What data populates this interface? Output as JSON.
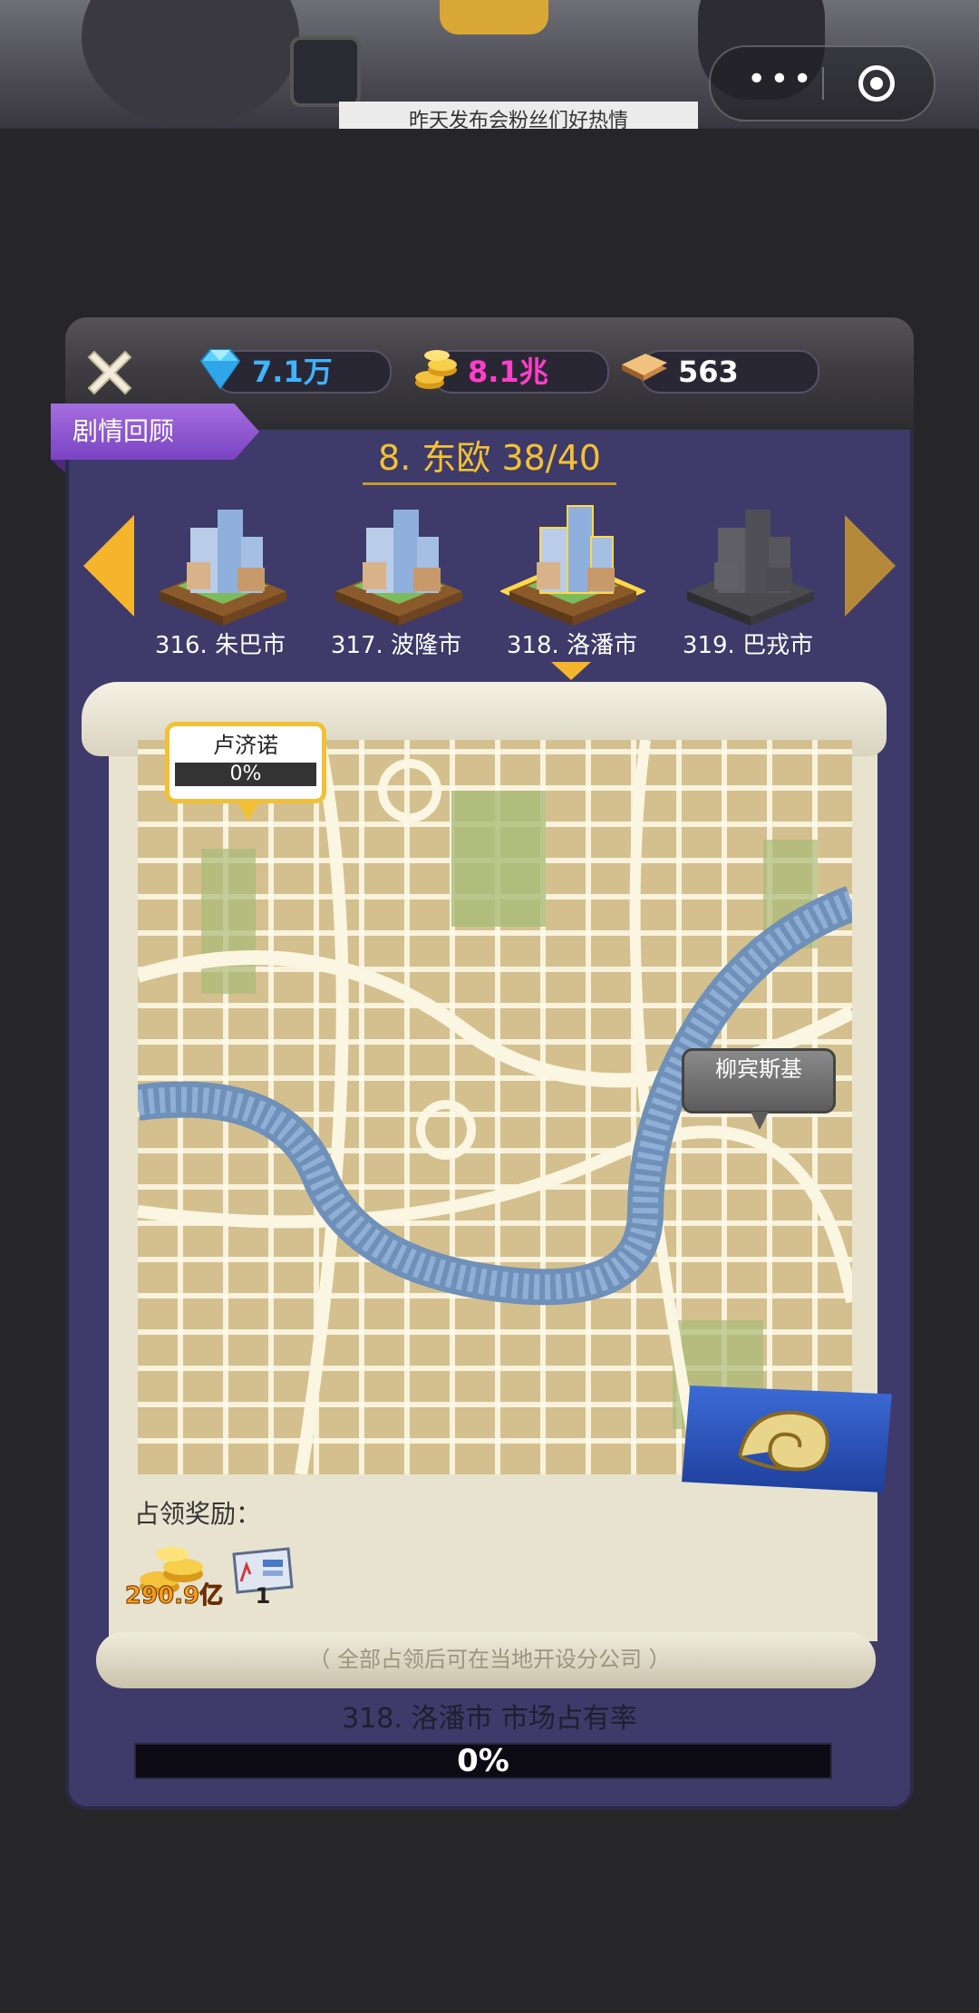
{
  "top": {
    "ticker_text": "昨天发布会粉丝们好热情"
  },
  "resources": {
    "diamonds": "7.1万",
    "coins": "8.1兆",
    "tickets": "563"
  },
  "story_tag": "剧情回顾",
  "region_title": "8. 东欧 38/40",
  "cities": [
    {
      "label": "316. 朱巴市",
      "state": "unlocked"
    },
    {
      "label": "317. 波隆市",
      "state": "unlocked"
    },
    {
      "label": "318. 洛潘市",
      "state": "selected"
    },
    {
      "label": "319. 巴戎市",
      "state": "locked"
    }
  ],
  "districts": [
    {
      "name": "卢济诺",
      "progress_text": "0%",
      "progress": 0
    },
    {
      "name": "柳宾斯基"
    }
  ],
  "rewards": {
    "title": "占领奖励：",
    "coin_amount": "290.9亿",
    "card_amount": "1"
  },
  "note": "（ 全部占领后可在当地开设分公司 ）",
  "market_share": {
    "label": "318. 洛潘市 市场占有率",
    "progress_text": "0%",
    "progress": 0
  },
  "colors": {
    "panel": "#3e3a6a",
    "accent_gold": "#f4b52c",
    "diamond_text": "#3fb4ff",
    "coin_text": "#ff3fc8"
  }
}
